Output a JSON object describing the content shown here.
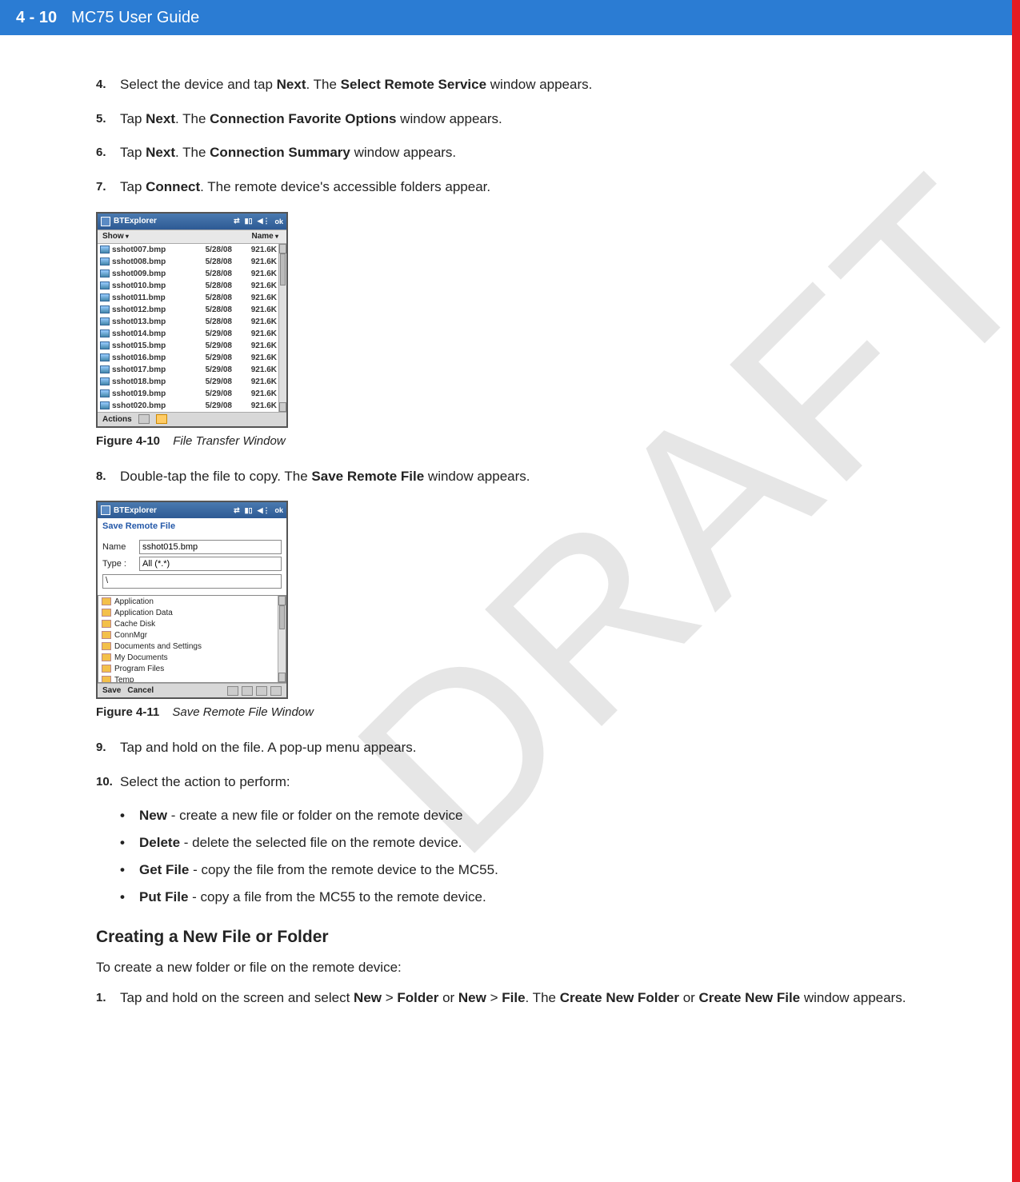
{
  "header": {
    "page": "4 - 10",
    "title": "MC75 User Guide"
  },
  "watermark": "DRAFT",
  "steps_a": [
    {
      "n": "4.",
      "pre": "Select the device and tap ",
      "b1": "Next",
      "mid": ". The ",
      "b2": "Select Remote Service",
      "post": " window appears."
    },
    {
      "n": "5.",
      "pre": "Tap ",
      "b1": "Next",
      "mid": ". The ",
      "b2": "Connection Favorite Options",
      "post": " window appears."
    },
    {
      "n": "6.",
      "pre": "Tap ",
      "b1": "Next",
      "mid": ". The ",
      "b2": "Connection Summary",
      "post": " window appears."
    },
    {
      "n": "7.",
      "pre": "Tap ",
      "b1": "Connect",
      "mid": ". The remote device's accessible folders appear.",
      "b2": "",
      "post": ""
    }
  ],
  "ss1": {
    "title": "BTExplorer",
    "ok": "ok",
    "col_show": "Show",
    "col_name": "Name",
    "actions": "Actions",
    "rows": [
      {
        "name": "sshot007.bmp",
        "date": "5/28/08",
        "size": "921.6K"
      },
      {
        "name": "sshot008.bmp",
        "date": "5/28/08",
        "size": "921.6K"
      },
      {
        "name": "sshot009.bmp",
        "date": "5/28/08",
        "size": "921.6K"
      },
      {
        "name": "sshot010.bmp",
        "date": "5/28/08",
        "size": "921.6K"
      },
      {
        "name": "sshot011.bmp",
        "date": "5/28/08",
        "size": "921.6K"
      },
      {
        "name": "sshot012.bmp",
        "date": "5/28/08",
        "size": "921.6K"
      },
      {
        "name": "sshot013.bmp",
        "date": "5/28/08",
        "size": "921.6K"
      },
      {
        "name": "sshot014.bmp",
        "date": "5/29/08",
        "size": "921.6K"
      },
      {
        "name": "sshot015.bmp",
        "date": "5/29/08",
        "size": "921.6K"
      },
      {
        "name": "sshot016.bmp",
        "date": "5/29/08",
        "size": "921.6K"
      },
      {
        "name": "sshot017.bmp",
        "date": "5/29/08",
        "size": "921.6K"
      },
      {
        "name": "sshot018.bmp",
        "date": "5/29/08",
        "size": "921.6K"
      },
      {
        "name": "sshot019.bmp",
        "date": "5/29/08",
        "size": "921.6K"
      },
      {
        "name": "sshot020.bmp",
        "date": "5/29/08",
        "size": "921.6K"
      }
    ]
  },
  "fig1": {
    "label": "Figure 4-10",
    "title": "File Transfer Window"
  },
  "step8": {
    "n": "8.",
    "pre": "Double-tap the file to copy. The ",
    "b1": "Save Remote File",
    "post": " window appears."
  },
  "ss2": {
    "title": "BTExplorer",
    "ok": "ok",
    "header": "Save Remote File",
    "name_label": "Name",
    "name_value": "sshot015.bmp",
    "type_label": "Type :",
    "type_value": "All (*.*)",
    "path_value": "\\",
    "save": "Save",
    "cancel": "Cancel",
    "folders": [
      "Application",
      "Application Data",
      "Cache Disk",
      "ConnMgr",
      "Documents and Settings",
      "My Documents",
      "Program Files",
      "Temp"
    ]
  },
  "fig2": {
    "label": "Figure 4-11",
    "title": "Save Remote File Window"
  },
  "step9": {
    "n": "9.",
    "text": "Tap and hold on the file. A pop-up menu appears."
  },
  "step10": {
    "n": "10.",
    "text": "Select the action to perform:"
  },
  "bullets": [
    {
      "b": "New",
      "t": " - create a new file or folder on the remote device"
    },
    {
      "b": "Delete",
      "t": " - delete the selected file on the remote device."
    },
    {
      "b": "Get File",
      "t": " - copy the file from the remote device to the MC55."
    },
    {
      "b": "Put File",
      "t": " - copy a file from the MC55 to the remote device."
    }
  ],
  "subheading": "Creating a New File or Folder",
  "para1": "To create a new folder or file on the remote device:",
  "step_b1": {
    "n": "1.",
    "pre": "Tap and hold on the screen and select ",
    "b1": "New",
    "gt1": " > ",
    "b2": "Folder",
    "or": " or ",
    "b3": "New",
    "gt2": " > ",
    "b4": "File",
    "mid": ". The ",
    "b5": "Create New Folder",
    "or2": " or ",
    "b6": "Create New File",
    "post": " window appears."
  }
}
